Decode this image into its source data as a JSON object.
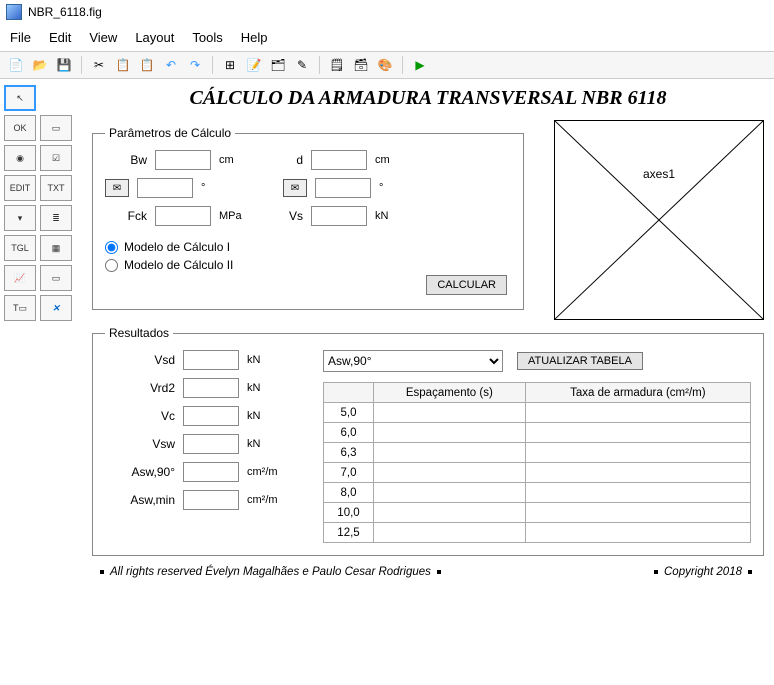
{
  "window": {
    "title": "NBR_6118.fig"
  },
  "menubar": [
    "File",
    "Edit",
    "View",
    "Layout",
    "Tools",
    "Help"
  ],
  "main_title": "CÁLCULO DA ARMADURA TRANSVERSAL NBR 6118",
  "params": {
    "legend": "Parâmetros de Cálculo",
    "bw": {
      "label": "Bw",
      "value": "",
      "unit": "cm"
    },
    "d": {
      "label": "d",
      "value": "",
      "unit": "cm"
    },
    "ang1": {
      "value": "",
      "unit": "°"
    },
    "ang2": {
      "value": "",
      "unit": "°"
    },
    "fck": {
      "label": "Fck",
      "value": "",
      "unit": "MPa"
    },
    "vs": {
      "label": "Vs",
      "value": "",
      "unit": "kN"
    },
    "radio1": "Modelo de Cálculo I",
    "radio2": "Modelo de Cálculo II",
    "calc_button": "CALCULAR"
  },
  "axes": {
    "label": "axes1"
  },
  "results": {
    "legend": "Resultados",
    "fields": {
      "vsd": {
        "label": "Vsd",
        "value": "",
        "unit": "kN"
      },
      "vrd2": {
        "label": "Vrd2",
        "value": "",
        "unit": "kN"
      },
      "vc": {
        "label": "Vc",
        "value": "",
        "unit": "kN"
      },
      "vsw": {
        "label": "Vsw",
        "value": "",
        "unit": "kN"
      },
      "asw90": {
        "label": "Asw,90°",
        "value": "",
        "unit": "cm²/m"
      },
      "aswmin": {
        "label": "Asw,min",
        "value": "",
        "unit": "cm²/m"
      }
    },
    "combo_selected": "Asw,90°",
    "update_button": "ATUALIZAR TABELA",
    "table": {
      "headers": [
        "",
        "Espaçamento (s)",
        "Taxa de armadura (cm²/m)"
      ],
      "rows": [
        "5,0",
        "6,0",
        "6,3",
        "7,0",
        "8,0",
        "10,0",
        "12,5"
      ]
    }
  },
  "footer": {
    "left": "All rights reserved Évelyn Magalhães e Paulo Cesar Rodrigues",
    "right": "Copyright 2018"
  }
}
